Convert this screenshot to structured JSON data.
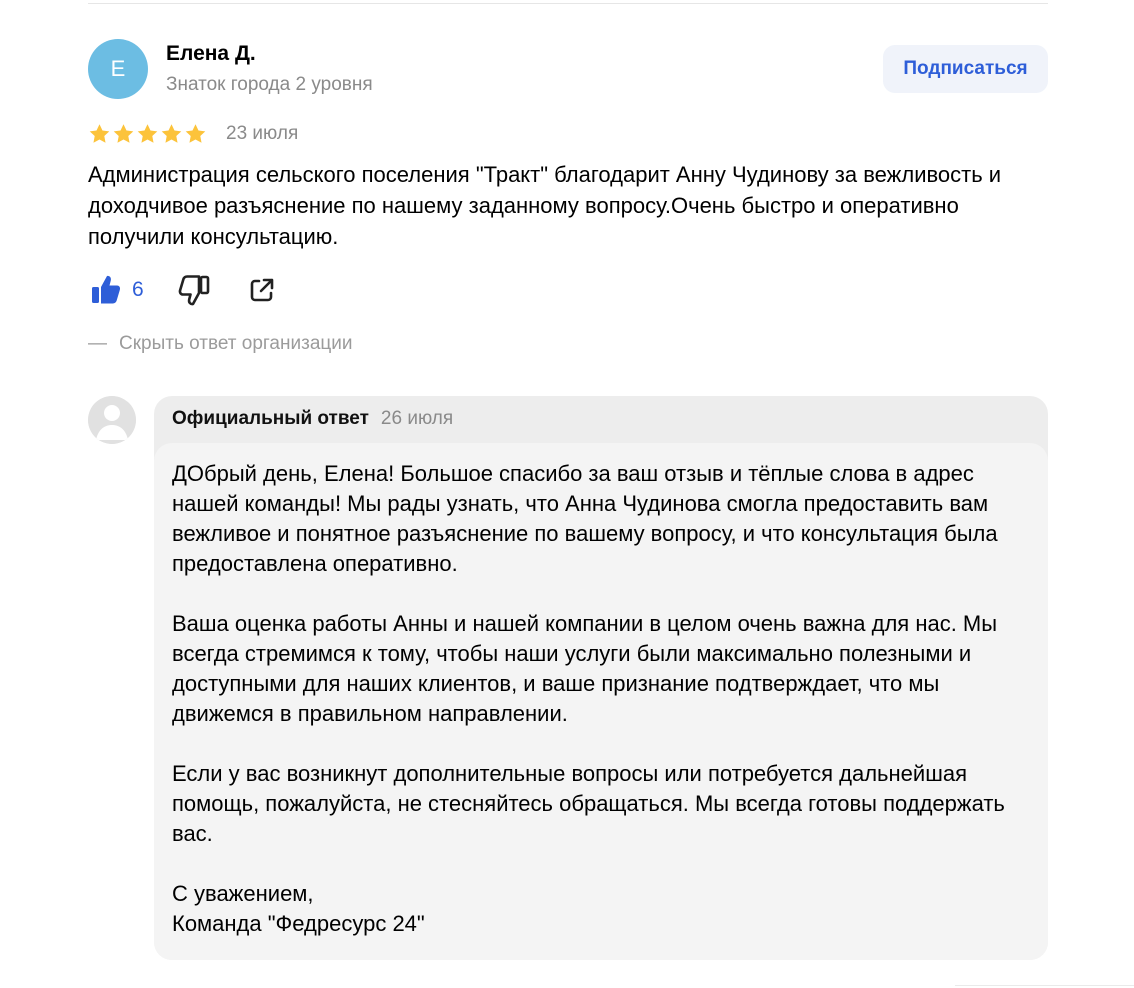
{
  "review": {
    "author_initial": "Е",
    "author_name": "Елена Д.",
    "author_level": "Знаток города 2 уровня",
    "subscribe_label": "Подписаться",
    "rating": 5,
    "date": "23 июля",
    "text": "Администрация сельского поселения \"Тракт\" благодарит Анну Чудинову за вежливость и доходчивое разъяснение по нашему заданному вопросу.Очень быстро и оперативно получили консультацию.",
    "likes": "6",
    "hide_reply_dash": "—",
    "hide_reply_label": "Скрыть ответ организации"
  },
  "reply": {
    "label": "Официальный ответ",
    "date": "26 июля",
    "paragraphs": [
      "ДОбрый день, Елена! Большое спасибо за ваш отзыв и тёплые слова в адрес нашей команды! Мы рады узнать, что Анна Чудинова смогла предоставить вам вежливое и понятное разъяснение по вашему вопросу, и что консультация была предоставлена оперативно.",
      "Ваша оценка работы Анны и нашей компании в целом очень важна для нас. Мы всегда стремимся к тому, чтобы наши услуги были максимально полезными и доступными для наших клиентов, и ваше признание подтверждает, что мы движемся в правильном направлении.",
      "Если у вас возникнут дополнительные вопросы или потребуется дальнейшая помощь, пожалуйста, не стесняйтесь обращаться. Мы всегда готовы поддержать вас.",
      "С уважением,\nКоманда \"Федресурс 24\""
    ]
  },
  "colors": {
    "accent": "#2e5ed8",
    "star": "#fcc33b",
    "avatar": "#6cbde3"
  },
  "icons": [
    "thumb-up-icon",
    "thumb-down-icon",
    "share-icon",
    "star-icon",
    "org-avatar-icon"
  ]
}
